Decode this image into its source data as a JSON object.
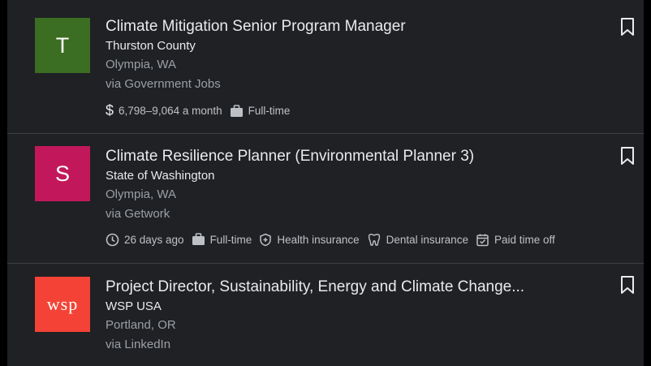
{
  "jobs": [
    {
      "logo_letter": "T",
      "logo_color": "#3b6d22",
      "title": "Climate Mitigation Senior Program Manager",
      "company": "Thurston County",
      "location": "Olympia, WA",
      "via": "via Government Jobs",
      "salary": "6,798–9,064 a month",
      "salary_icon": "dollar-icon",
      "type": "Full-time"
    },
    {
      "logo_letter": "S",
      "logo_color": "#c2185b",
      "title": "Climate Resilience Planner (Environmental Planner 3)",
      "company": "State of Washington",
      "location": "Olympia, WA",
      "via": "via Getwork",
      "posted": "26 days ago",
      "type": "Full-time",
      "health": "Health insurance",
      "dental": "Dental insurance",
      "pto": "Paid time off"
    },
    {
      "logo_letter": "wsp",
      "logo_color": "#f44336",
      "title": "Project Director, Sustainability, Energy and Climate Change...",
      "company": "WSP USA",
      "location": "Portland, OR",
      "via": "via LinkedIn"
    }
  ],
  "colors": {
    "panel_bg": "#202124",
    "primary_text": "#e8eaed",
    "secondary_text": "#9aa0a6"
  }
}
